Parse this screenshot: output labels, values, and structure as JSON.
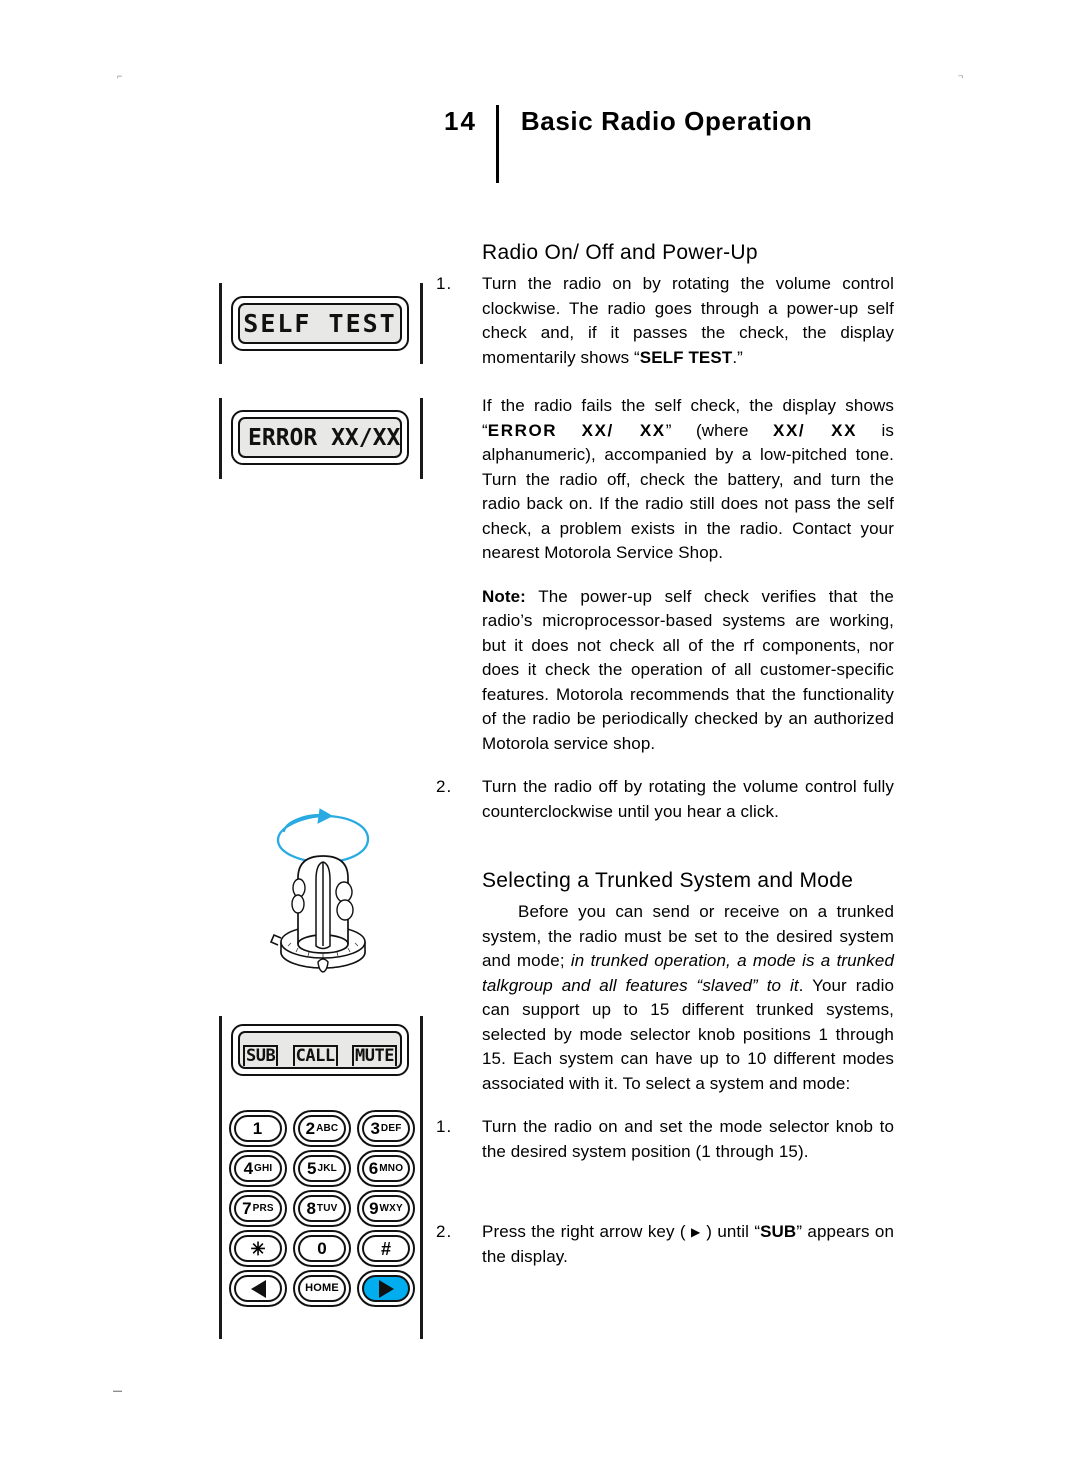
{
  "header": {
    "chapter_number": "14",
    "title": "Basic Radio Operation"
  },
  "registration_marks": {
    "top_left": "⌐",
    "top_right": "¬",
    "bottom_left": "▬"
  },
  "illustrations": {
    "display_self_test": {
      "label": "self-test-display",
      "text": "SELF TEST"
    },
    "display_error": {
      "label": "error-display",
      "text": "ERROR XX/XX"
    },
    "volume_knob": {
      "label": "volume-knob-illustration",
      "arrow_color": "#29ABE2"
    },
    "display_status": {
      "label": "sub-call-mute-display",
      "cells": [
        "SUB",
        "CALL",
        "MUTE"
      ]
    },
    "keypad": {
      "highlight_color": "#00AEEF",
      "rows": [
        [
          {
            "digit": "1",
            "letters": ""
          },
          {
            "digit": "2",
            "letters": "ABC"
          },
          {
            "digit": "3",
            "letters": "DEF"
          }
        ],
        [
          {
            "digit": "4",
            "letters": "GHI"
          },
          {
            "digit": "5",
            "letters": "JKL"
          },
          {
            "digit": "6",
            "letters": "MNO"
          }
        ],
        [
          {
            "digit": "7",
            "letters": "PRS"
          },
          {
            "digit": "8",
            "letters": "TUV"
          },
          {
            "digit": "9",
            "letters": "WXY"
          }
        ],
        [
          {
            "digit": "✳",
            "letters": ""
          },
          {
            "digit": "0",
            "letters": ""
          },
          {
            "digit": "#",
            "letters": ""
          }
        ]
      ],
      "bottom_row": {
        "left_arrow": "left-arrow-key",
        "home": "HOME",
        "right_arrow": "right-arrow-key"
      }
    }
  },
  "sections": {
    "power_up": {
      "heading": "Radio On/ Off and Power-Up",
      "step1": {
        "number": "1.",
        "text_before": "Turn the radio on by rotating the volume control clockwise. The radio goes through a power-up self check and, if it passes the check, the display momentarily shows “",
        "bold": "SELF TEST",
        "text_after": ".”"
      },
      "error_para": {
        "p1": "If the radio fails the self check, the display shows “",
        "b1": "ERROR",
        "gap1": "  ",
        "b2": "XX/ XX",
        "p2": "”  (where  ",
        "b3": "XX/ XX",
        "p3": "  is alphanumeric), accompanied by a low-pitched tone. Turn the radio off, check the battery, and turn the radio back on. If the radio still does not pass the self check, a problem exists in the radio. Contact your nearest Motorola Service Shop."
      },
      "note": {
        "label": "Note:",
        "text": " The power-up self check verifies that the radio’s microprocessor-based systems are working, but it does not check all of the rf components, nor does it check the operation of all customer-specific features. Motorola recommends that the functionality of the radio be periodically checked by an authorized Motorola service shop."
      },
      "step2": {
        "number": "2.",
        "text": "Turn the radio off by rotating the volume control fully counterclockwise until you hear a click."
      }
    },
    "trunked": {
      "heading": "Selecting a Trunked System and Mode",
      "intro": {
        "p1": "Before you can send or receive on a trunked system, the radio must be set to the desired system and mode; ",
        "i1": "in trunked operation, a mode is a trunked talkgroup and all features “slaved” to it",
        "p2": ". Your radio can support up to 15 different trunked systems, selected by mode selector knob positions 1 through 15. Each system can have up to 10 different modes associated with it. To select a system and mode:"
      },
      "step1": {
        "number": "1.",
        "text": "Turn the radio on and set the mode selector knob to the desired system position (1 through 15)."
      },
      "step2": {
        "number": "2.",
        "text_before": "Press the right arrow key ( ",
        "arrow": "▶",
        "text_mid": " ) until “",
        "bold": "SUB",
        "text_after": "” appears on the display."
      }
    }
  }
}
